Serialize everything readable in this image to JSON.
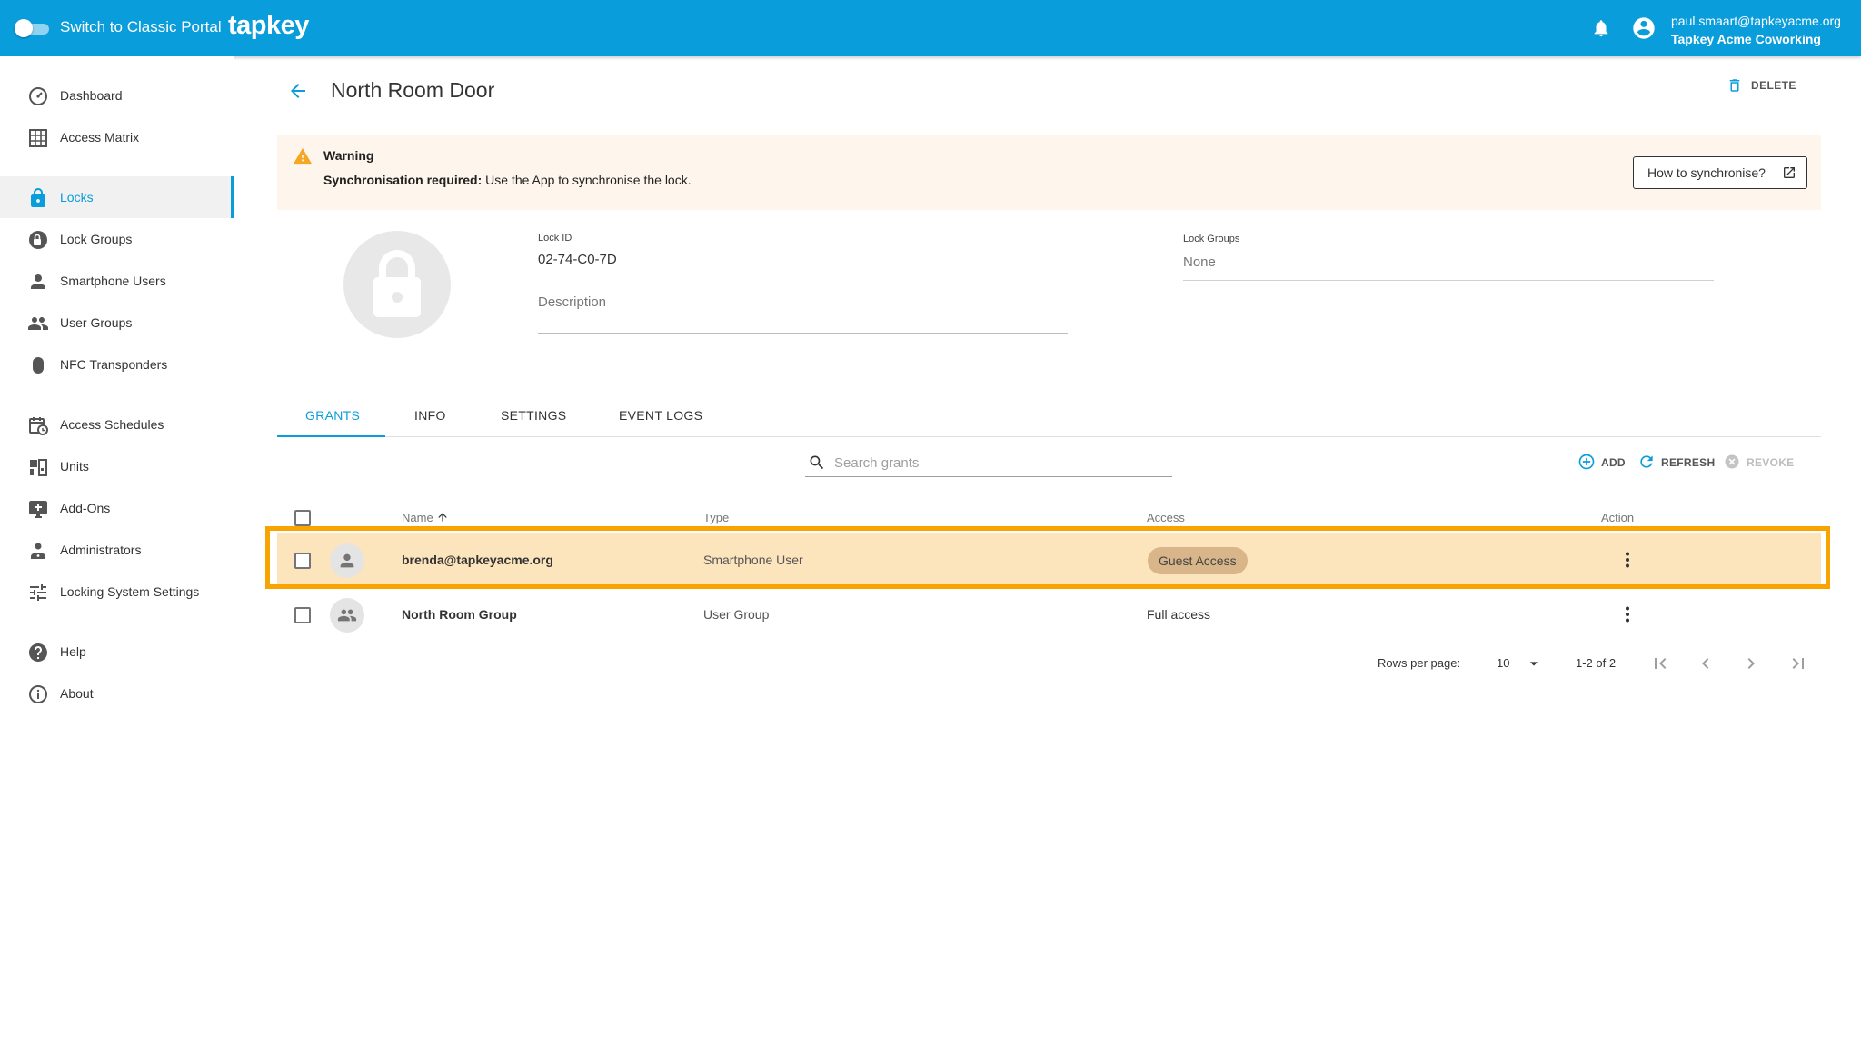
{
  "topbar": {
    "switch_label": "Switch to Classic Portal",
    "logo": "tapkey",
    "user_email": "paul.smaart@tapkeyacme.org",
    "user_org": "Tapkey Acme Coworking"
  },
  "sidebar": {
    "items": [
      {
        "label": "Dashboard",
        "icon": "dashboard-icon"
      },
      {
        "label": "Access Matrix",
        "icon": "grid-icon"
      },
      {
        "label": "Locks",
        "icon": "lock-icon",
        "active": true
      },
      {
        "label": "Lock Groups",
        "icon": "lock-groups-icon"
      },
      {
        "label": "Smartphone Users",
        "icon": "person-icon"
      },
      {
        "label": "User Groups",
        "icon": "people-icon"
      },
      {
        "label": "NFC Transponders",
        "icon": "transponder-icon"
      },
      {
        "label": "Access Schedules",
        "icon": "calendar-clock-icon"
      },
      {
        "label": "Units",
        "icon": "units-icon"
      },
      {
        "label": "Add-Ons",
        "icon": "add-on-icon"
      },
      {
        "label": "Administrators",
        "icon": "admin-icon"
      },
      {
        "label": "Locking System Settings",
        "icon": "sliders-icon"
      },
      {
        "label": "Help",
        "icon": "help-icon"
      },
      {
        "label": "About",
        "icon": "info-icon"
      }
    ]
  },
  "page": {
    "title": "North Room Door",
    "delete_label": "DELETE"
  },
  "warning": {
    "title": "Warning",
    "message_bold": "Synchronisation required:",
    "message": "Use the App to synchronise the lock.",
    "button_label": "How to synchronise?"
  },
  "details": {
    "lock_id_label": "Lock ID",
    "lock_id": "02-74-C0-7D",
    "description_placeholder": "Description",
    "lock_groups_label": "Lock Groups",
    "lock_groups_value": "None"
  },
  "tabs": [
    "GRANTS",
    "INFO",
    "SETTINGS",
    "EVENT LOGS"
  ],
  "grants": {
    "search_placeholder": "Search grants",
    "add_label": "ADD",
    "refresh_label": "REFRESH",
    "revoke_label": "REVOKE",
    "columns": [
      "Name",
      "Type",
      "Access",
      "Action"
    ],
    "rows": [
      {
        "name": "brenda@tapkeyacme.org",
        "type": "Smartphone User",
        "access": "Guest Access",
        "selected": true
      },
      {
        "name": "North Room Group",
        "type": "User Group",
        "access": "Full access",
        "selected": false
      }
    ],
    "pagination": {
      "rows_per_page_label": "Rows per page:",
      "rows_per_page": "10",
      "range": "1-2 of 2"
    }
  },
  "colors": {
    "brand": "#0a9ddb",
    "warning_bg": "#fef6ec",
    "warning_icon": "#f5a623",
    "selected_row": "#fce4bc",
    "highlight": "#f7a400",
    "chip": "#d9b68a"
  }
}
